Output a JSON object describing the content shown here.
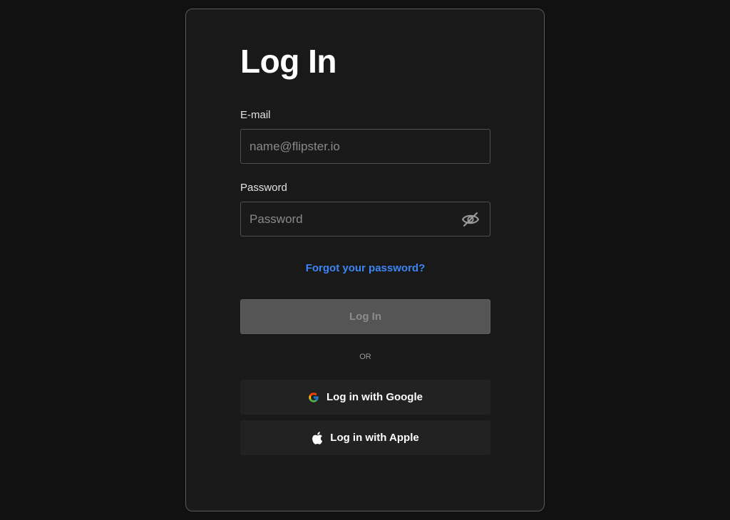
{
  "form": {
    "title": "Log In",
    "email": {
      "label": "E-mail",
      "value": "",
      "placeholder": "name@flipster.io"
    },
    "password": {
      "label": "Password",
      "value": "",
      "placeholder": "Password",
      "toggle_icon": "eye-off-icon"
    },
    "forgot_password_link": "Forgot your password?",
    "login_button": "Log In",
    "divider_text": "OR",
    "google_button": {
      "label": "Log in with Google",
      "icon": "google-icon"
    },
    "apple_button": {
      "label": "Log in with Apple",
      "icon": "apple-icon"
    }
  },
  "colors": {
    "background": "#111111",
    "card": "#191919",
    "link": "#3d84f5",
    "disabled_button": "#555555",
    "social_button": "#222222"
  }
}
